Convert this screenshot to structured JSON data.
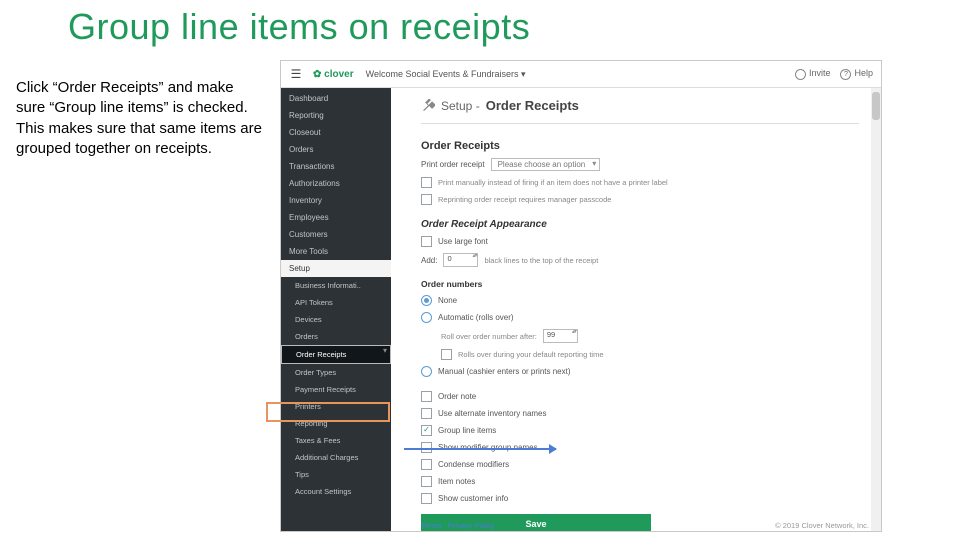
{
  "slide": {
    "title": "Group line items on receipts",
    "instruction": "Click “Order Receipts” and make sure “Group line items” is checked.  This makes sure that same items are grouped together on receipts."
  },
  "topbar": {
    "brand": "clover",
    "merchant": "Welcome Social Events & Fundraisers ▾",
    "invite": "Invite",
    "help": "Help"
  },
  "sidebar": {
    "items": [
      "Dashboard",
      "Reporting",
      "Closeout",
      "Orders",
      "Transactions",
      "Authorizations",
      "Inventory",
      "Employees",
      "Customers",
      "More Tools"
    ],
    "setup": "Setup",
    "subs": [
      "Business Informati..",
      "API Tokens",
      "Devices",
      "Orders",
      "Order Receipts",
      "Order Types",
      "Payment Receipts",
      "Printers",
      "Reporting",
      "Taxes & Fees",
      "Additional Charges",
      "Tips",
      "Account Settings"
    ]
  },
  "page": {
    "heading_prefix": "Setup -",
    "heading": "Order Receipts",
    "section1": "Order Receipts",
    "print_label": "Print order receipt",
    "print_select": "Please choose an option",
    "opt_manual": "Print manually instead of firing if an item does not have a printer label",
    "opt_reprint": "Reprinting order receipt requires manager passcode",
    "appearance": "Order Receipt Appearance",
    "large_font": "Use large font",
    "add_n": "Add:",
    "add_val": "0",
    "add_tail": "black lines to the top of the receipt",
    "order_numbers": "Order numbers",
    "radio_none": "None",
    "radio_auto": "Automatic (rolls over)",
    "rollover": "Roll over order number after:",
    "rollover_val": "99",
    "rollover_note": "Rolls over during your default reporting time",
    "radio_manual": "Manual (cashier enters or prints next)",
    "chk_order_note": "Order note",
    "chk_alt_inv": "Use alternate inventory names",
    "chk_group": "Group line items",
    "chk_modgroup": "Show modifier group names",
    "chk_condense": "Condense modifiers",
    "chk_item_notes": "Item notes",
    "chk_cust": "Show customer info",
    "save": "Save"
  },
  "footer": {
    "terms": "Terms",
    "privacy": "Privacy Policy",
    "copyright": "© 2019 Clover Network, Inc."
  }
}
